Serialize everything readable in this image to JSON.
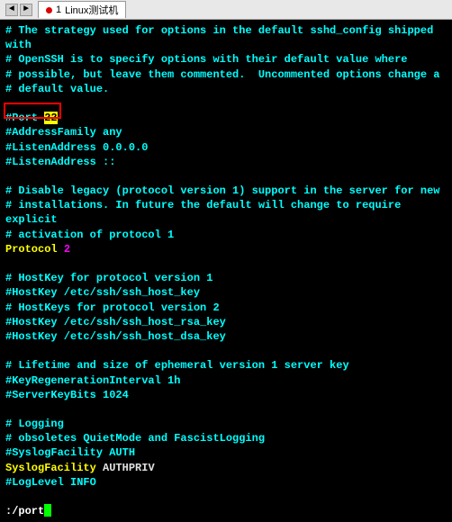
{
  "tabbar": {
    "ctrl_left": "◄",
    "ctrl_right": "►",
    "tab_number": "1",
    "tab_label": "Linux测试机"
  },
  "config": {
    "l1": "# The strategy used for options in the default sshd_config shipped with",
    "l2": "# OpenSSH is to specify options with their default value where",
    "l3": "# possible, but leave them commented.  Uncommented options change a",
    "l4": "# default value.",
    "l5_port_label": "#Port ",
    "l5_port_value": "22",
    "l6": "#AddressFamily any",
    "l7": "#ListenAddress 0.0.0.0",
    "l8": "#ListenAddress ::",
    "l9": "# Disable legacy (protocol version 1) support in the server for new",
    "l10": "# installations. In future the default will change to require explicit",
    "l11": "# activation of protocol 1",
    "l12_key": "Protocol",
    "l12_val": "2",
    "l13": "# HostKey for protocol version 1",
    "l14": "#HostKey /etc/ssh/ssh_host_key",
    "l15": "# HostKeys for protocol version 2",
    "l16": "#HostKey /etc/ssh/ssh_host_rsa_key",
    "l17": "#HostKey /etc/ssh/ssh_host_dsa_key",
    "l18": "# Lifetime and size of ephemeral version 1 server key",
    "l19": "#KeyRegenerationInterval 1h",
    "l20": "#ServerKeyBits 1024",
    "l21": "# Logging",
    "l22": "# obsoletes QuietMode and FascistLogging",
    "l23": "#SyslogFacility AUTH",
    "l24_key": "SyslogFacility",
    "l24_val": "AUTHPRIV",
    "l25": "#LogLevel INFO"
  },
  "status": {
    "search": ":/port"
  }
}
